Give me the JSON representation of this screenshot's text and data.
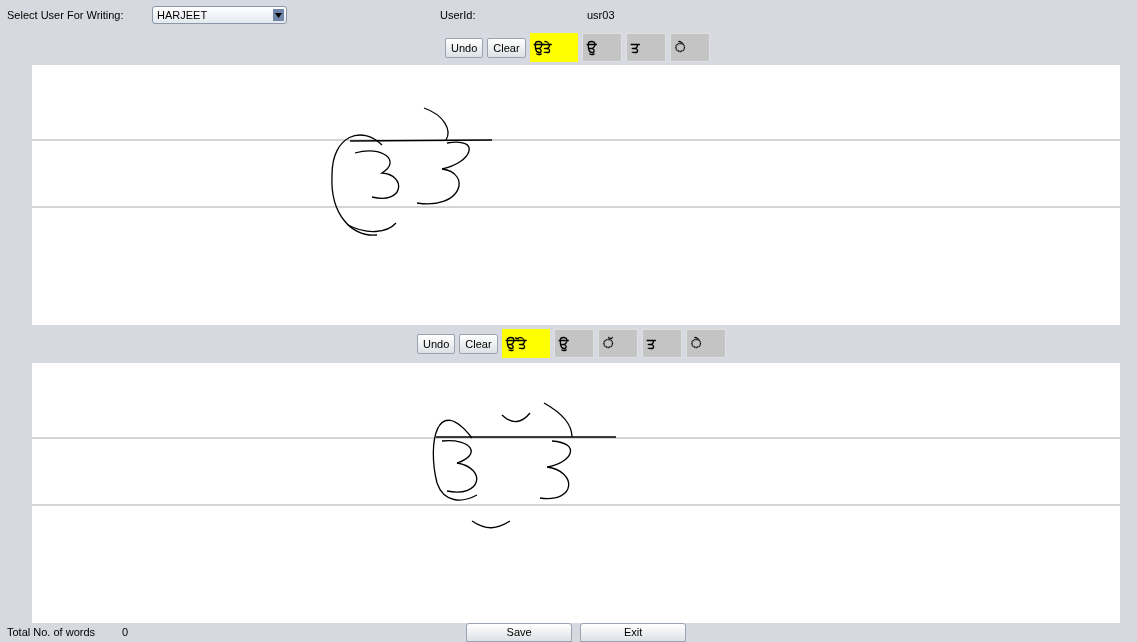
{
  "header": {
    "user_label": "Select User For Writing:",
    "user_value": "HARJEET",
    "userid_label": "UserId:",
    "userid_value": "usr03"
  },
  "panels": [
    {
      "tiles": [
        {
          "glyph": "ਉਤੇ",
          "selected": true
        },
        {
          "glyph": "ਉ",
          "selected": false
        },
        {
          "glyph": "ਤ",
          "selected": false
        },
        {
          "glyph": "◌ੇ",
          "selected": false
        }
      ],
      "undo": "Undo",
      "clear": "Clear"
    },
    {
      "tiles": [
        {
          "glyph": "ਉੱਤੇ",
          "selected": true
        },
        {
          "glyph": "ਉ",
          "selected": false
        },
        {
          "glyph": "◌ੱ",
          "selected": false
        },
        {
          "glyph": "ਤ",
          "selected": false
        },
        {
          "glyph": "◌ੇ",
          "selected": false
        }
      ],
      "undo": "Undo",
      "clear": "Clear"
    }
  ],
  "footer": {
    "count_label": "Total No. of words",
    "count_value": "0",
    "save": "Save",
    "exit": "Exit"
  }
}
